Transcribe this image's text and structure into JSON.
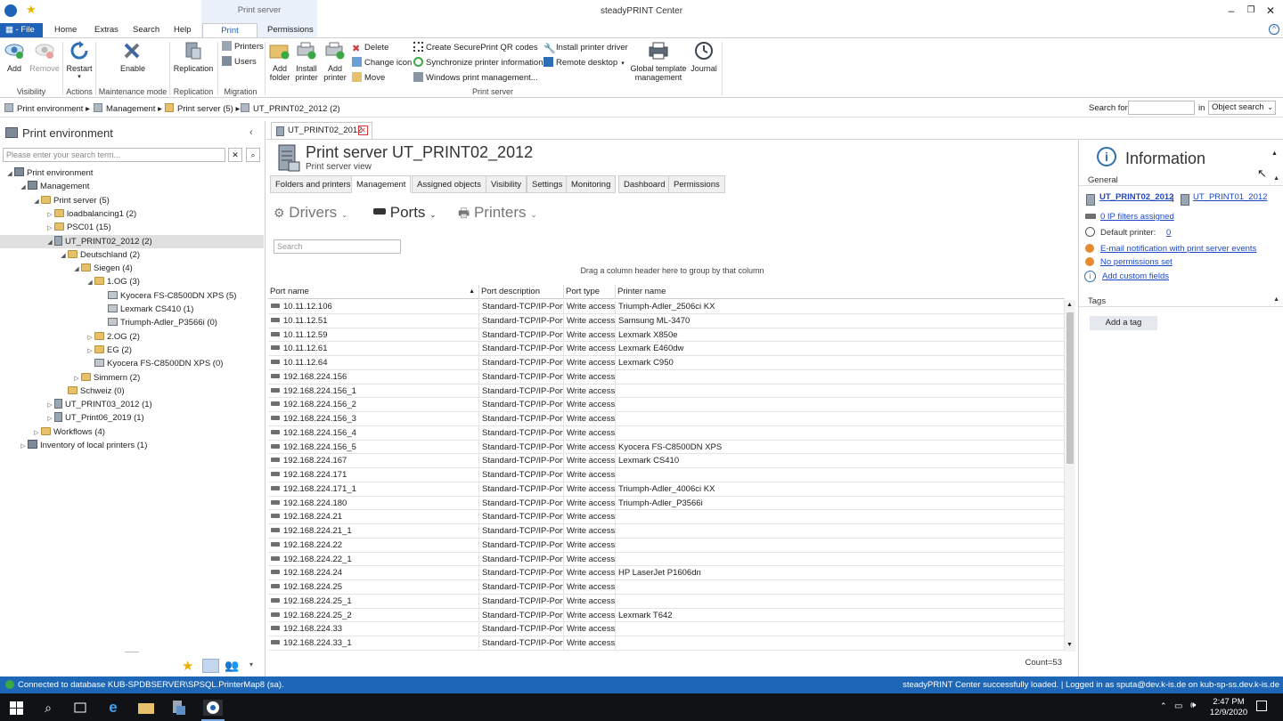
{
  "window": {
    "title": "steadyPRINT Center",
    "context_tab_group": "Print server"
  },
  "ribbon_tabs": [
    "File",
    "Home",
    "Extras",
    "Search",
    "Help",
    "Print server",
    "Permissions"
  ],
  "ribbon": {
    "visibility": {
      "add": "Add",
      "remove": "Remove",
      "group": "Visibility"
    },
    "actions": {
      "restart": "Restart",
      "group": "Actions"
    },
    "maintenance": {
      "enable": "Enable",
      "group": "Maintenance mode"
    },
    "replication": {
      "replication": "Replication",
      "group": "Replication"
    },
    "migration": {
      "printers": "Printers",
      "users": "Users",
      "group": "Migration"
    },
    "print_server": {
      "add_folder_1": "Add",
      "add_folder_2": "folder",
      "install_printer_1": "Install",
      "install_printer_2": "printer",
      "add_printer_1": "Add",
      "add_printer_2": "printer",
      "delete": "Delete",
      "change_icon": "Change icon",
      "move": "Move",
      "create_qr": "Create SecurePrint QR codes",
      "sync_info": "Synchronize printer information",
      "windows_mgmt": "Windows print management...",
      "install_driver": "Install printer driver",
      "remote_desktop": "Remote desktop",
      "global_template_1": "Global template",
      "global_template_2": "management",
      "journal": "Journal",
      "group": "Print server"
    }
  },
  "breadcrumb": [
    "Print environment",
    "Management",
    "Print server (5)",
    "UT_PRINT02_2012 (2)"
  ],
  "search_bar": {
    "label": "Search for",
    "in_label": "in",
    "scope": "Object search",
    "value": ""
  },
  "left_panel": {
    "title": "Print environment",
    "search_placeholder": "Please enter your search term...",
    "tree": [
      {
        "label": "Print environment",
        "level": 0,
        "type": "root",
        "expanded": true
      },
      {
        "label": "Management",
        "level": 1,
        "type": "root",
        "expanded": true
      },
      {
        "label": "Print server (5)",
        "level": 2,
        "type": "folder",
        "expanded": true
      },
      {
        "label": "loadbalancing1 (2)",
        "level": 3,
        "type": "folder",
        "expanded": false
      },
      {
        "label": "PSC01 (15)",
        "level": 3,
        "type": "folder",
        "expanded": false
      },
      {
        "label": "UT_PRINT02_2012 (2)",
        "level": 3,
        "type": "server",
        "expanded": true,
        "selected": true
      },
      {
        "label": "Deutschland (2)",
        "level": 4,
        "type": "folder",
        "expanded": true
      },
      {
        "label": "Siegen (4)",
        "level": 5,
        "type": "folder",
        "expanded": true
      },
      {
        "label": "1.OG (3)",
        "level": 6,
        "type": "folder",
        "expanded": true
      },
      {
        "label": "Kyocera FS-C8500DN XPS (5)",
        "level": 7,
        "type": "printer"
      },
      {
        "label": "Lexmark CS410 (1)",
        "level": 7,
        "type": "printer"
      },
      {
        "label": "Triumph-Adler_P3566i (0)",
        "level": 7,
        "type": "printer"
      },
      {
        "label": "2.OG (2)",
        "level": 6,
        "type": "folder",
        "expanded": false
      },
      {
        "label": "EG (2)",
        "level": 6,
        "type": "folder",
        "expanded": false
      },
      {
        "label": "Kyocera FS-C8500DN XPS (0)",
        "level": 6,
        "type": "printer"
      },
      {
        "label": "Simmern (2)",
        "level": 5,
        "type": "folder",
        "expanded": false
      },
      {
        "label": "Schweiz (0)",
        "level": 4,
        "type": "folder"
      },
      {
        "label": "UT_PRINT03_2012 (1)",
        "level": 3,
        "type": "server",
        "expanded": false
      },
      {
        "label": "UT_Print06_2019 (1)",
        "level": 3,
        "type": "server",
        "expanded": false
      },
      {
        "label": "Workflows (4)",
        "level": 2,
        "type": "folder",
        "expanded": false
      },
      {
        "label": "Inventory of local printers (1)",
        "level": 1,
        "type": "root",
        "expanded": false
      }
    ]
  },
  "document_tab": "UT_PRINT02_2012",
  "center": {
    "title": "Print server UT_PRINT02_2012",
    "subtitle": "Print server view",
    "tabs": [
      "Folders and printers",
      "Management",
      "Assigned objects",
      "Visibility",
      "Settings",
      "Monitoring",
      "Dashboard",
      "Permissions"
    ],
    "active_tab": "Management",
    "subnav": [
      "Drivers",
      "Ports",
      "Printers"
    ],
    "active_subnav": "Ports",
    "grid_search_placeholder": "Search",
    "group_hint": "Drag a column header here to group by that column",
    "columns": [
      "Port name",
      "Port description",
      "Port type",
      "Printer name"
    ],
    "rows": [
      [
        "10.11.12.106",
        "Standard-TCP/IP-Port",
        "Write access",
        "Triumph-Adler_2506ci KX"
      ],
      [
        "10.11.12.51",
        "Standard-TCP/IP-Port",
        "Write access",
        "Samsung ML-3470"
      ],
      [
        "10.11.12.59",
        "Standard-TCP/IP-Port",
        "Write access",
        "Lexmark X850e"
      ],
      [
        "10.11.12.61",
        "Standard-TCP/IP-Port",
        "Write access",
        "Lexmark E460dw"
      ],
      [
        "10.11.12.64",
        "Standard-TCP/IP-Port",
        "Write access",
        "Lexmark C950"
      ],
      [
        "192.168.224.156",
        "Standard-TCP/IP-Port",
        "Write access",
        ""
      ],
      [
        "192.168.224.156_1",
        "Standard-TCP/IP-Port",
        "Write access",
        ""
      ],
      [
        "192.168.224.156_2",
        "Standard-TCP/IP-Port",
        "Write access",
        ""
      ],
      [
        "192.168.224.156_3",
        "Standard-TCP/IP-Port",
        "Write access",
        ""
      ],
      [
        "192.168.224.156_4",
        "Standard-TCP/IP-Port",
        "Write access",
        ""
      ],
      [
        "192.168.224.156_5",
        "Standard-TCP/IP-Port",
        "Write access",
        "Kyocera FS-C8500DN XPS"
      ],
      [
        "192.168.224.167",
        "Standard-TCP/IP-Port",
        "Write access",
        "Lexmark CS410"
      ],
      [
        "192.168.224.171",
        "Standard-TCP/IP-Port",
        "Write access",
        ""
      ],
      [
        "192.168.224.171_1",
        "Standard-TCP/IP-Port",
        "Write access",
        "Triumph-Adler_4006ci KX"
      ],
      [
        "192.168.224.180",
        "Standard-TCP/IP-Port",
        "Write access",
        "Triumph-Adler_P3566i"
      ],
      [
        "192.168.224.21",
        "Standard-TCP/IP-Port",
        "Write access",
        ""
      ],
      [
        "192.168.224.21_1",
        "Standard-TCP/IP-Port",
        "Write access",
        ""
      ],
      [
        "192.168.224.22",
        "Standard-TCP/IP-Port",
        "Write access",
        ""
      ],
      [
        "192.168.224.22_1",
        "Standard-TCP/IP-Port",
        "Write access",
        ""
      ],
      [
        "192.168.224.24",
        "Standard-TCP/IP-Port",
        "Write access",
        "HP LaserJet P1606dn"
      ],
      [
        "192.168.224.25",
        "Standard-TCP/IP-Port",
        "Write access",
        ""
      ],
      [
        "192.168.224.25_1",
        "Standard-TCP/IP-Port",
        "Write access",
        ""
      ],
      [
        "192.168.224.25_2",
        "Standard-TCP/IP-Port",
        "Write access",
        "Lexmark T642"
      ],
      [
        "192.168.224.33",
        "Standard-TCP/IP-Port",
        "Write access",
        ""
      ],
      [
        "192.168.224.33_1",
        "Standard-TCP/IP-Port",
        "Write access",
        ""
      ]
    ],
    "count": "Count=53"
  },
  "right_panel": {
    "title": "Information",
    "general_label": "General",
    "server_link_1": "UT_PRINT02_2012",
    "server_sep": "|",
    "server_link_2": "UT_PRINT01_2012",
    "ip_filters": "0 IP filters assigned",
    "default_printer_label": "Default printer:",
    "default_printer_value": "0",
    "email_notification": "E-mail notification with print server events",
    "no_permissions": "No permissions set",
    "add_custom_fields": "Add custom fields",
    "tags_label": "Tags",
    "add_tag": "Add a tag"
  },
  "status_bar": {
    "left": "Connected to database KUB-SPDBSERVER\\SPSQL.PrinterMap8 (sa).",
    "right": "steadyPRINT Center successfully loaded. | Logged in as sputa@dev.k-is.de on kub-sp-ss.dev.k-is.de"
  },
  "taskbar": {
    "time": "2:47 PM",
    "date": "12/9/2020"
  },
  "colors": {
    "accent": "#1e63b8",
    "status_bar": "#1e67b7",
    "taskbar": "#101216",
    "link": "#1e48c8",
    "warning_dot": "#e58a2e"
  }
}
